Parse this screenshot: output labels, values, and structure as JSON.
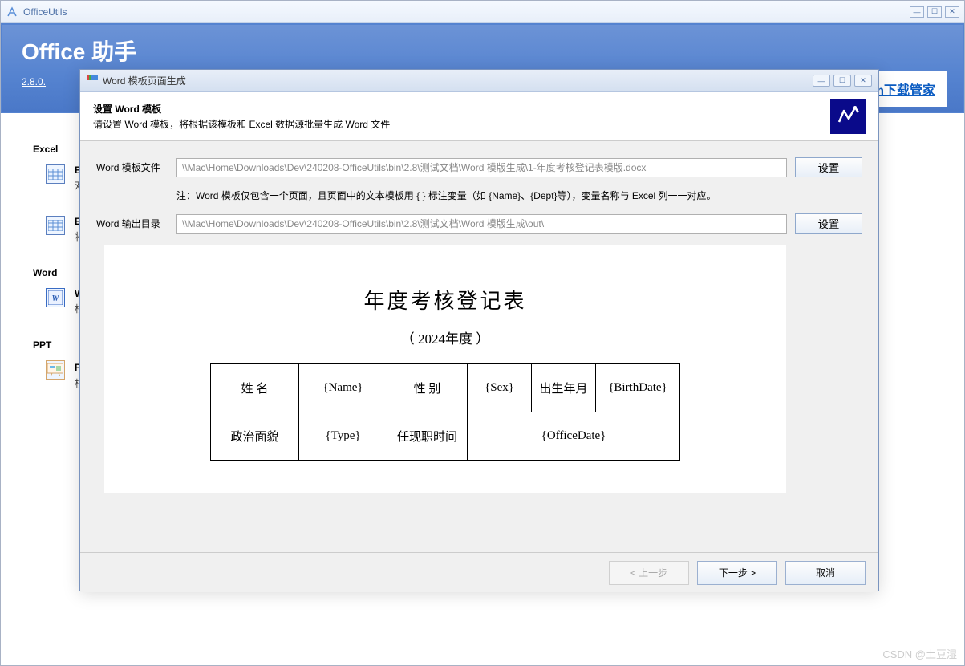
{
  "mainWindow": {
    "title": "OfficeUtils",
    "banner": {
      "title": "Office 助手",
      "version": "2.8.0."
    },
    "steam": {
      "label": "Steam下载管家"
    },
    "sections": {
      "excel": {
        "label": "Excel",
        "items": [
          {
            "title": "Exce",
            "desc": "对 E"
          },
          {
            "title": "Exce",
            "desc": "将 E"
          }
        ]
      },
      "word": {
        "label": "Word",
        "items": [
          {
            "title": "Word",
            "desc": "根据"
          }
        ]
      },
      "ppt": {
        "label": "PPT",
        "items": [
          {
            "title": "PPT 模板页面生成",
            "desc": "根据 PPT 模板和 Excel 数据，自动生成 PPT 页面。"
          }
        ]
      }
    }
  },
  "dialog": {
    "title": "Word 模板页面生成",
    "header": {
      "title": "设置 Word 模板",
      "subtitle": "请设置 Word 模板，将根据该模板和 Excel 数据源批量生成 Word 文件"
    },
    "form": {
      "templateLabel": "Word 模板文件",
      "templateValue": "\\\\Mac\\Home\\Downloads\\Dev\\240208-OfficeUtils\\bin\\2.8\\测试文档\\Word 模版生成\\1-年度考核登记表模版.docx",
      "note": "注：Word 模板仅包含一个页面，且页面中的文本模板用 { } 标注变量（如 {Name}、{Dept}等），变量名称与 Excel 列一一对应。",
      "outputLabel": "Word 输出目录",
      "outputValue": "\\\\Mac\\Home\\Downloads\\Dev\\240208-OfficeUtils\\bin\\2.8\\测试文档\\Word 模版生成\\out\\",
      "setButton": "设置"
    },
    "preview": {
      "title": "年度考核登记表",
      "subtitle": "（ 2024年度 ）",
      "table": {
        "c1": "姓  名",
        "c2": "{Name}",
        "c3": "性  别",
        "c4": "{Sex}",
        "c5": "出生年月",
        "c6": "{BirthDate}",
        "c7": "政治面貌",
        "c8": "{Type}",
        "c9": "任现职时间",
        "c10": "{OfficeDate}"
      }
    },
    "footer": {
      "prev": "< 上一步",
      "next": "下一步 >",
      "cancel": "取消"
    }
  },
  "watermark": "CSDN @土豆湿"
}
